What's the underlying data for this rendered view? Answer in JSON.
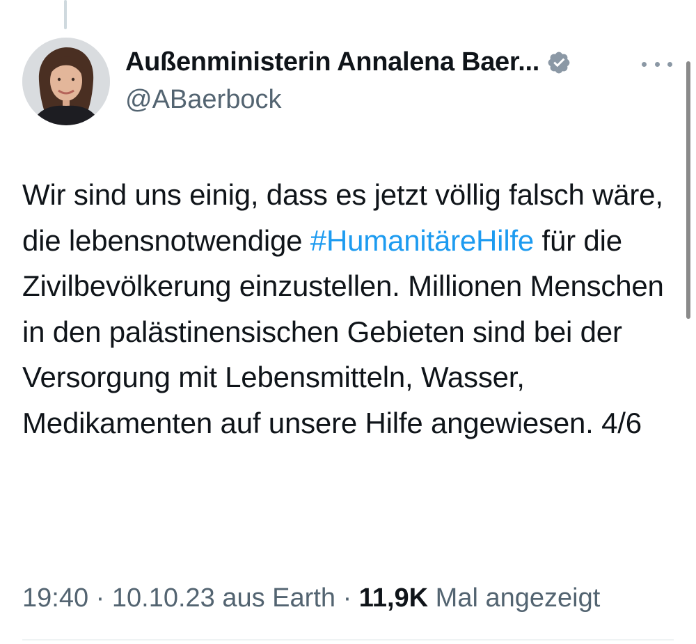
{
  "author": {
    "display_name": "Außenministerin Annalena Baer...",
    "handle": "@ABaerbock",
    "verified_icon": "verified-badge-icon",
    "badge_color": "#8b98a5"
  },
  "tweet": {
    "text_before_hashtag": "Wir sind uns einig, dass es jetzt völlig falsch wäre, die lebensnotwendige ",
    "hashtag": "#HumanitäreHilfe",
    "text_after_hashtag": " für die Zivilbevölkerung einzustellen. Millionen Menschen in den palästinensischen Gebieten sind bei der Versorgung mit Lebensmitteln, Wasser, Medikamenten auf unsere Hilfe angewiesen. 4/6"
  },
  "meta": {
    "time": "19:40",
    "separator1": " · ",
    "date": "10.10.23",
    "source": " aus Earth",
    "separator2": " · ",
    "views_count": "11,9K",
    "views_label": " Mal angezeigt"
  },
  "colors": {
    "link": "#1d9bf0",
    "secondary_text": "#536471",
    "primary_text": "#0f1419"
  }
}
